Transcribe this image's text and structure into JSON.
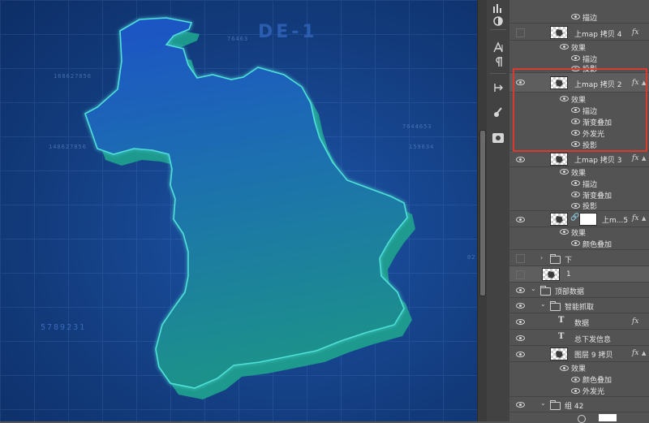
{
  "canvas": {
    "watermarks": [
      "DE-1",
      "76463",
      "168627856",
      "148627856",
      "7644653",
      "159634",
      "1261860",
      "4865631",
      "02",
      "5789231"
    ],
    "colors": {
      "background": "#174690",
      "map_top": "#1e58c8",
      "map_bottom": "#1a8f8c",
      "edge_glow": "#4fe0d8",
      "extrusion": "#1fa38f"
    }
  },
  "toolstrip": {
    "icons": [
      "histogram-icon",
      "adjustment-icon",
      "character-icon",
      "paragraph-icon",
      "transform-icon",
      "brush-icon",
      "stamp-icon"
    ]
  },
  "layers": {
    "rows": [
      {
        "kind": "effect",
        "label": "描边"
      },
      {
        "kind": "layer",
        "label": "上map 拷贝 4",
        "visible": false,
        "fx": "fx"
      },
      {
        "kind": "effect-group",
        "label": "效果"
      },
      {
        "kind": "effect",
        "label": "描边"
      },
      {
        "kind": "effect",
        "label": "投影"
      },
      {
        "kind": "layer",
        "label": "上map 拷贝 2",
        "visible": true,
        "fx": "fx"
      },
      {
        "kind": "effect-group",
        "label": "效果"
      },
      {
        "kind": "effect",
        "label": "描边"
      },
      {
        "kind": "effect",
        "label": "渐变叠加"
      },
      {
        "kind": "effect",
        "label": "外发光"
      },
      {
        "kind": "effect",
        "label": "投影"
      },
      {
        "kind": "layer",
        "label": "上map 拷贝 3",
        "visible": true,
        "fx": "fx"
      },
      {
        "kind": "effect-group",
        "label": "效果"
      },
      {
        "kind": "effect",
        "label": "描边"
      },
      {
        "kind": "effect",
        "label": "渐变叠加"
      },
      {
        "kind": "effect",
        "label": "投影"
      },
      {
        "kind": "layer-mask",
        "label": "上m...5",
        "visible": true,
        "fx": "fx"
      },
      {
        "kind": "effect-group",
        "label": "效果"
      },
      {
        "kind": "effect",
        "label": "颜色叠加"
      },
      {
        "kind": "group",
        "label": "下",
        "visible": false
      },
      {
        "kind": "layer",
        "label": "1",
        "visible": false
      },
      {
        "kind": "group-open",
        "label": "顶部数据",
        "visible": true
      },
      {
        "kind": "group-open-2",
        "label": "智能抓取",
        "visible": true
      },
      {
        "kind": "text",
        "label": "数据",
        "visible": true,
        "fx": "fx"
      },
      {
        "kind": "text",
        "label": "总下发信息",
        "visible": true
      },
      {
        "kind": "layer",
        "label": "图层 9 拷贝",
        "visible": true,
        "fx": "fx"
      },
      {
        "kind": "effect-group",
        "label": "效果"
      },
      {
        "kind": "effect",
        "label": "颜色叠加"
      },
      {
        "kind": "effect",
        "label": "外发光"
      },
      {
        "kind": "group-open",
        "label": "组 42",
        "visible": true
      }
    ]
  }
}
